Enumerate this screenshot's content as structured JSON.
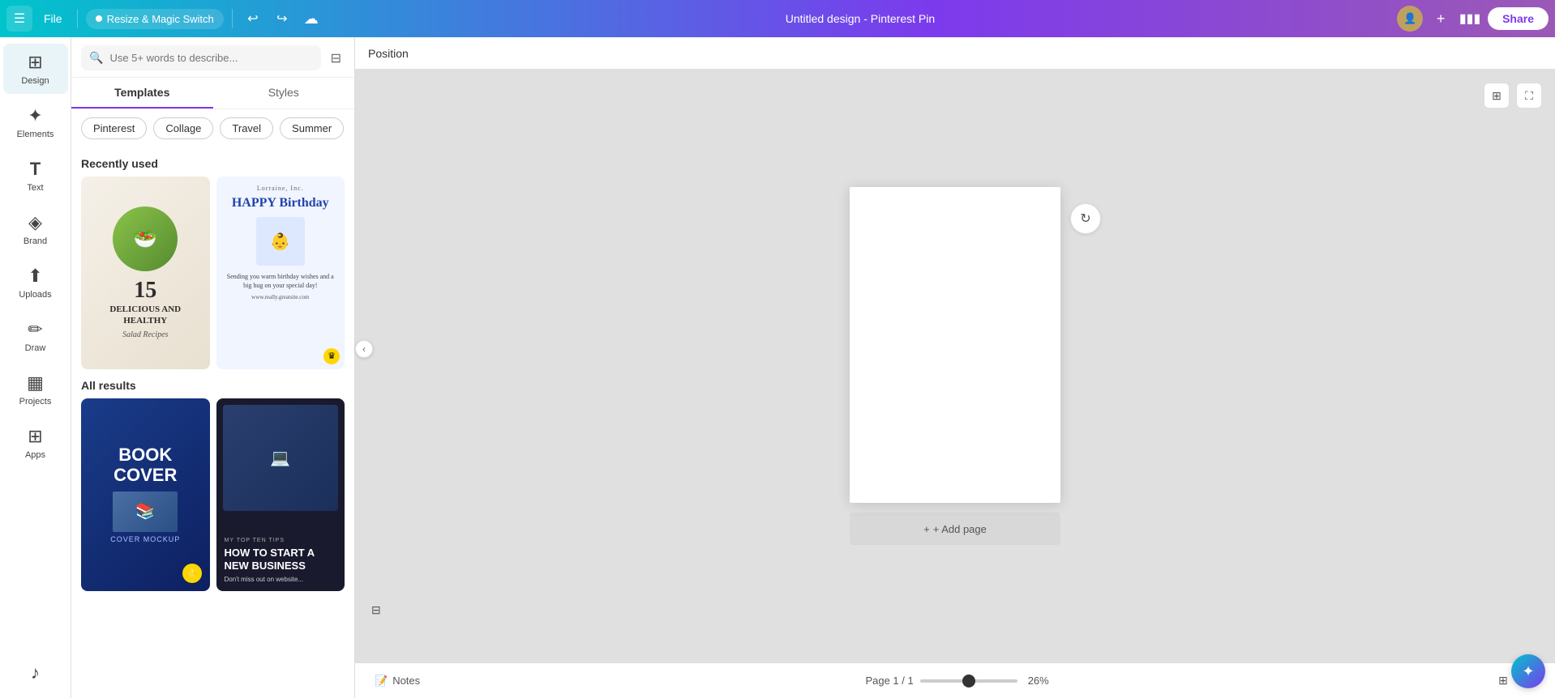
{
  "topbar": {
    "menu_label": "☰",
    "file_label": "File",
    "magic_label": "Resize & Magic Switch",
    "undo_label": "↩",
    "redo_label": "↪",
    "cloud_label": "☁",
    "title": "Untitled design - Pinterest Pin",
    "add_label": "+",
    "share_label": "Share"
  },
  "position_bar": {
    "label": "Position"
  },
  "sidebar": {
    "items": [
      {
        "id": "design",
        "icon": "⊞",
        "label": "Design"
      },
      {
        "id": "elements",
        "icon": "✦",
        "label": "Elements"
      },
      {
        "id": "text",
        "icon": "T",
        "label": "Text"
      },
      {
        "id": "brand",
        "icon": "◈",
        "label": "Brand"
      },
      {
        "id": "uploads",
        "icon": "⬆",
        "label": "Uploads"
      },
      {
        "id": "draw",
        "icon": "✏",
        "label": "Draw"
      },
      {
        "id": "projects",
        "icon": "▦",
        "label": "Projects"
      },
      {
        "id": "apps",
        "icon": "⊞",
        "label": "Apps"
      }
    ]
  },
  "panel": {
    "search_placeholder": "Use 5+ words to describe...",
    "tabs": [
      {
        "id": "templates",
        "label": "Templates",
        "active": true
      },
      {
        "id": "styles",
        "label": "Styles",
        "active": false
      }
    ],
    "filter_chips": [
      {
        "label": "Pinterest"
      },
      {
        "label": "Collage"
      },
      {
        "label": "Travel"
      },
      {
        "label": "Summer"
      }
    ],
    "sections": [
      {
        "id": "recently-used",
        "title": "Recently used",
        "templates": [
          {
            "id": "salad",
            "type": "salad",
            "number": "15",
            "line1": "DELICIOUS AND",
            "line2": "HEALTHY",
            "line3": "Salad Recipes",
            "premium": false
          },
          {
            "id": "birthday",
            "type": "birthday",
            "header": "Lorraine, Inc.",
            "title": "HAPPY Birthday",
            "body": "Sending you warm birthday wishes and a big hug on your special day!",
            "url": "www.really.greatsite.com",
            "premium": true
          }
        ]
      },
      {
        "id": "all-results",
        "title": "All results",
        "templates": [
          {
            "id": "book-cover",
            "type": "book",
            "title": "BOOK COVER",
            "subtitle": "COVER MOCKUP",
            "premium": false
          },
          {
            "id": "new-business",
            "type": "business",
            "tag": "MY TOP TEN TIPS",
            "title": "HOW TO START A NEW BUSINESS",
            "body": "Don't miss out on website...",
            "premium": false
          }
        ]
      }
    ]
  },
  "canvas": {
    "add_page_label": "+ Add page",
    "page_indicator": "Page 1 / 1",
    "zoom_level": "26%"
  },
  "bottom_bar": {
    "notes_label": "Notes",
    "page_info": "Page 1 / 1",
    "zoom": "26%",
    "show_pages_label": "⊞"
  },
  "icons": {
    "menu": "☰",
    "search": "🔍",
    "filter": "⊞",
    "undo": "↩",
    "redo": "↪",
    "cloud": "☁",
    "plus": "+",
    "chevron_left": "‹",
    "chevron_right": "›",
    "refresh": "↻",
    "notes": "📝",
    "grid": "⊞",
    "expand": "⛶",
    "hide": "‹",
    "crown": "♛",
    "star": "✦"
  }
}
